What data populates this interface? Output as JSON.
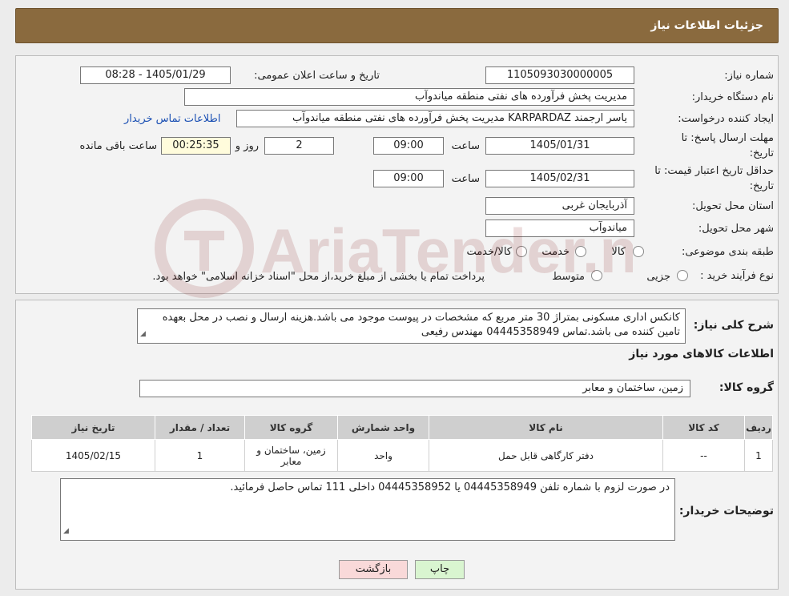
{
  "header": {
    "title": "جزئیات اطلاعات نیاز"
  },
  "form": {
    "need_number_label": "شماره نیاز:",
    "need_number": "1105093030000005",
    "announce_label": "تاریخ و ساعت اعلان عمومی:",
    "announce_value": "1405/01/29 - 08:28",
    "buyer_org_label": "نام دستگاه خریدار:",
    "buyer_org": "مدیریت پخش فرآورده های نفتی منطقه میاندوآب",
    "creator_label": "ایجاد کننده درخواست:",
    "creator": "یاسر ارجمند KARPARDAZ مدیریت پخش فرآورده های نفتی منطقه میاندوآب",
    "contact_link": "اطلاعات تماس خریدار",
    "deadline_label_1": "مهلت ارسال پاسخ: تا",
    "deadline_label_2": "تاریخ:",
    "deadline_date": "1405/01/31",
    "time_label": "ساعت",
    "deadline_time": "09:00",
    "days_value": "2",
    "days_label": "روز و",
    "remaining_time": "00:25:35",
    "remaining_label": "ساعت باقی مانده",
    "validity_label_1": "حداقل تاریخ اعتبار قیمت: تا",
    "validity_label_2": "تاریخ:",
    "validity_date": "1405/02/31",
    "validity_time": "09:00",
    "province_label": "استان محل تحویل:",
    "province": "آذربایجان غربی",
    "city_label": "شهر محل تحویل:",
    "city": "میاندوآب",
    "category_label": "طبقه بندی موضوعی:",
    "category_options": [
      "کالا",
      "خدمت",
      "کالا/خدمت"
    ],
    "process_label": "نوع فرآیند خرید :",
    "process_options": [
      "جزیی",
      "متوسط"
    ],
    "process_note": "پرداخت تمام یا بخشی از مبلغ خرید،از محل \"اسناد خزانه اسلامی\" خواهد بود."
  },
  "description": {
    "label": "شرح کلی نیاز:",
    "text": "کانکس اداری مسکونی بمتراژ 30 متر مربع که مشخصات در پیوست موجود می باشد.هزینه ارسال و نصب در محل بعهده تامین کننده می باشد.تماس 04445358949 مهندس رفیعی"
  },
  "goods": {
    "section_title": "اطلاعات کالاهای مورد نیاز",
    "group_label": "گروه کالا:",
    "group_value": "زمین، ساختمان و معابر",
    "columns": [
      "ردیف",
      "کد کالا",
      "نام کالا",
      "واحد شمارش",
      "گروه کالا",
      "تعداد / مقدار",
      "تاریخ نیاز"
    ],
    "rows": [
      [
        "1",
        "--",
        "دفتر کارگاهی قابل حمل",
        "واحد",
        "زمین، ساختمان و معابر",
        "1",
        "1405/02/15"
      ]
    ]
  },
  "buyer_notes": {
    "label": "توضیحات خریدار:",
    "text": "در صورت لزوم با شماره تلفن 04445358949 یا 04445358952 داخلی 111 تماس حاصل فرمائید."
  },
  "buttons": {
    "print": "چاپ",
    "back": "بازگشت"
  },
  "watermark": {
    "text": "AriaTender.neT"
  },
  "icons": {
    "radio": "radio-button-icon",
    "resize": "resize-grip-icon",
    "watermark": "ariatender-logo-icon"
  },
  "colors": {
    "header": "#8a6a3e",
    "link": "#1a4fb3",
    "print_button": "#d9f5d0",
    "back_button": "#f9d9d9",
    "remaining_box": "#fffcdc"
  }
}
